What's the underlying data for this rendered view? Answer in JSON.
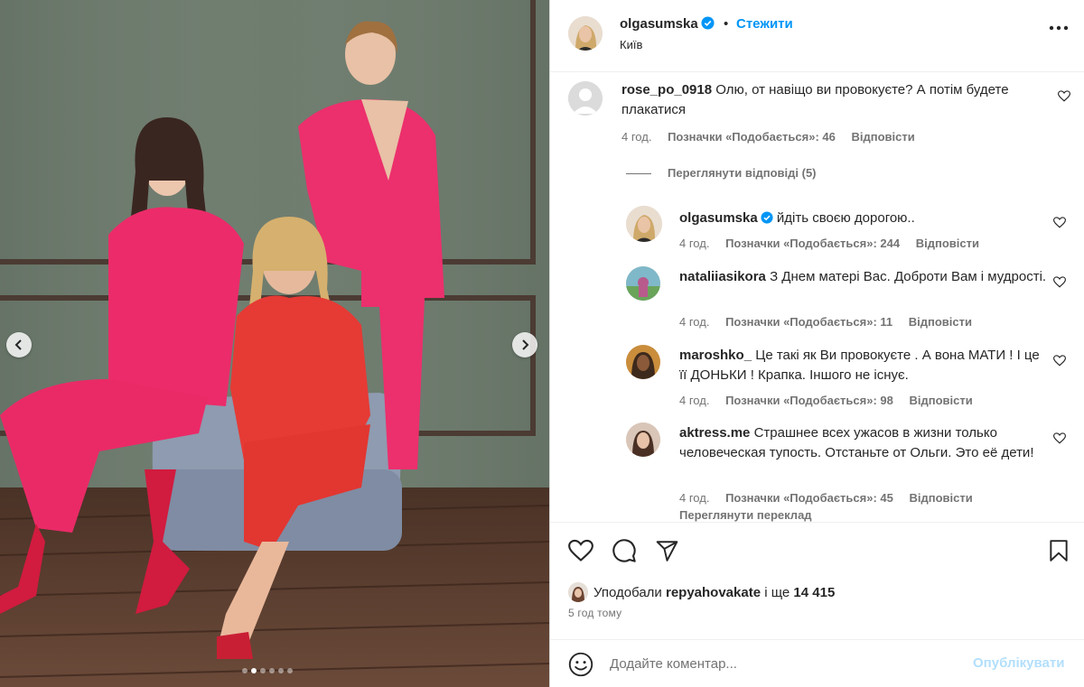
{
  "post": {
    "author": "olgasumska",
    "follow_label": "Стежити",
    "bullet": "•",
    "location": "Київ",
    "more_icon": "more-horizontal-icon",
    "carousel": {
      "total": 6,
      "active": 1
    }
  },
  "comments": [
    {
      "user": "rose_po_0918",
      "text": "Олю, от навіщо ви провокуєте? А потім будете плакатися",
      "time": "4 год.",
      "likes": "Позначки «Подобається»: 46",
      "reply": "Відповісти",
      "view_replies": "Переглянути відповіді (5)"
    }
  ],
  "replies": [
    {
      "user": "olgasumska",
      "verified": true,
      "text": "йдіть своєю дорогою..",
      "time": "4 год.",
      "likes": "Позначки «Подобається»: 244",
      "reply": "Відповісти"
    },
    {
      "user": "nataliiasikora",
      "text": "З Днем матері Вас. Доброти Вам і мудрості.",
      "time": "4 год.",
      "likes": "Позначки «Подобається»: 11",
      "reply": "Відповісти"
    },
    {
      "user": "maroshko_",
      "text": "Це такі як Ви провокуєте . А вона МАТИ ! І це її ДОНЬКИ ! Крапка. Іншого не існує.",
      "time": "4 год.",
      "likes": "Позначки «Подобається»: 98",
      "reply": "Відповісти"
    },
    {
      "user": "aktress.me",
      "text": "Страшнее всех ужасов в жизни только человеческая тупость. Отстаньте от Ольги. Это её дети!",
      "time": "4 год.",
      "likes": "Позначки «Подобається»: 45",
      "reply": "Відповісти",
      "view_translation": "Переглянути переклад"
    }
  ],
  "actions": {
    "liked_by_prefix": "Уподобали",
    "liked_by_user": "repyahovakate",
    "liked_by_conj": "і ще",
    "liked_by_count": "14 415",
    "posted_ago": "5 год тому"
  },
  "composer": {
    "placeholder": "Додайте коментар...",
    "publish": "Опублікувати"
  },
  "colors": {
    "accent": "#0095f6",
    "accent_disabled": "#b2dffc",
    "secondary_text": "#737373",
    "verified": "#0095f6"
  }
}
